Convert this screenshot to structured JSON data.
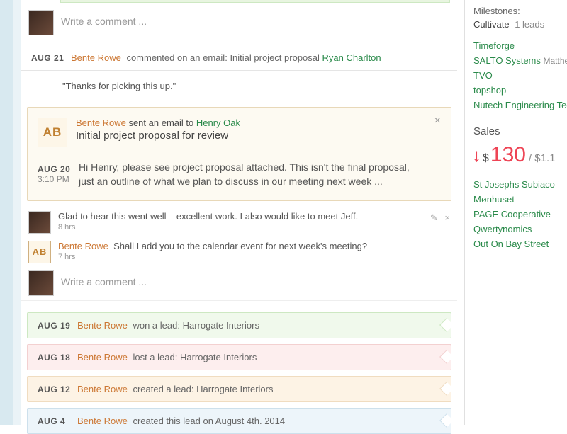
{
  "comment_placeholder": "Write a comment ...",
  "events": [
    {
      "date": "AUG 21",
      "author": "Bente Rowe",
      "action": "commented on an email:",
      "subject": "Initial project proposal",
      "link": "Ryan Charlton"
    }
  ],
  "quote": "\"Thanks for picking this up.\"",
  "email": {
    "avatar": "AB",
    "author": "Bente Rowe",
    "verb": "sent an email to",
    "recipient": "Henry Oak",
    "subject": "Initial project proposal for review",
    "date": "AUG 20",
    "time": "3:10 PM",
    "body": "Hi Henry, please see project proposal attached. This isn't the final proposal, just an outline of what we plan to discuss in our meeting next week ..."
  },
  "replies": [
    {
      "text": "Glad to hear this went well – excellent work. I also would like to meet Jeff.",
      "meta": "8 hrs"
    },
    {
      "avatar": "AB",
      "author": "Bente Rowe",
      "text": "Shall I add you to the calendar event for next week's meeting?",
      "meta": "7 hrs"
    }
  ],
  "lead_events": [
    {
      "date": "AUG 19",
      "author": "Bente Rowe",
      "action": "won a lead:",
      "lead": "Harrogate Interiors",
      "style": "green"
    },
    {
      "date": "AUG 18",
      "author": "Bente Rowe",
      "action": "lost a lead:",
      "lead": "Harrogate Interiors",
      "style": "pink"
    },
    {
      "date": "AUG 12",
      "author": "Bente Rowe",
      "action": "created a lead:",
      "lead": "Harrogate Interiors",
      "style": "orange"
    },
    {
      "date": "AUG 4",
      "author": "Bente Rowe",
      "action": "created this lead on August 4th. 2014",
      "lead": "",
      "style": "blue"
    }
  ],
  "sidebar": {
    "milestones_label": "Milestones:",
    "milestone": {
      "name": "Cultivate",
      "count": "1 leads"
    },
    "links1": [
      {
        "name": "Timeforge"
      },
      {
        "name": "SALTO Systems",
        "extra": "Matthew"
      },
      {
        "name": "TVO"
      },
      {
        "name": "topshop"
      },
      {
        "name": "Nutech Engineering Tech"
      }
    ],
    "sales_label": "Sales",
    "sales_big": "130",
    "sales_sub": "/ $1.1",
    "links2": [
      {
        "name": "St Josephs Subiaco"
      },
      {
        "name": "Mønhuset"
      },
      {
        "name": "PAGE Cooperative"
      },
      {
        "name": "Qwertynomics"
      },
      {
        "name": "Out On Bay Street"
      }
    ]
  }
}
